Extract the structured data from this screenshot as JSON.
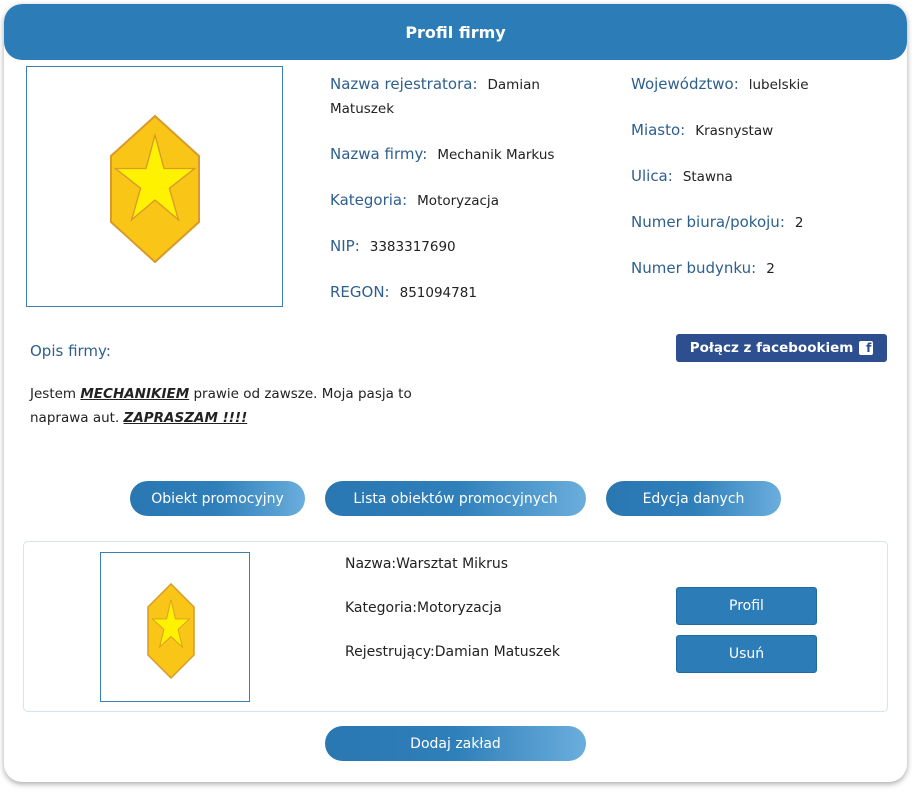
{
  "header": {
    "title": "Profil firmy"
  },
  "profile": {
    "left_fields": [
      {
        "label": "Nazwa rejestratora:",
        "value": "Damian Matuszek"
      },
      {
        "label": "Nazwa firmy:",
        "value": "Mechanik Markus"
      },
      {
        "label": "Kategoria:",
        "value": "Motoryzacja"
      },
      {
        "label": "NIP:",
        "value": "3383317690"
      },
      {
        "label": "REGON:",
        "value": "851094781"
      }
    ],
    "right_fields": [
      {
        "label": "Województwo:",
        "value": "lubelskie"
      },
      {
        "label": "Miasto:",
        "value": "Krasnystaw"
      },
      {
        "label": "Ulica:",
        "value": "Stawna"
      },
      {
        "label": "Numer biura/pokoju:",
        "value": "2"
      },
      {
        "label": "Numer budynku:",
        "value": "2"
      }
    ]
  },
  "description": {
    "label": "Opis firmy:",
    "part1": "Jestem ",
    "em1": "MECHANIKIEM",
    "part2": " prawie od zawsze. Moja pasja to naprawa aut. ",
    "em2": "ZAPRASZAM !!!!"
  },
  "facebook": {
    "label": "Połącz z facebookiem",
    "icon": "facebook-icon"
  },
  "actions": {
    "promo_object": "Obiekt promocyjny",
    "promo_list": "Lista obiektów promocyjnych",
    "edit_data": "Edycja danych"
  },
  "item": {
    "name": "Nazwa:Warsztat Mikrus",
    "category": "Kategoria:Motoryzacja",
    "registrant": "Rejestrujący:Damian Matuszek",
    "profile_btn": "Profil",
    "delete_btn": "Usuń"
  },
  "add_button": "Dodaj zakład",
  "colors": {
    "primary": "#2c7cb8",
    "facebook": "#2d4f8f",
    "label_text": "#2d5f8e",
    "gem": "#f5c518",
    "star": "#fff200"
  }
}
